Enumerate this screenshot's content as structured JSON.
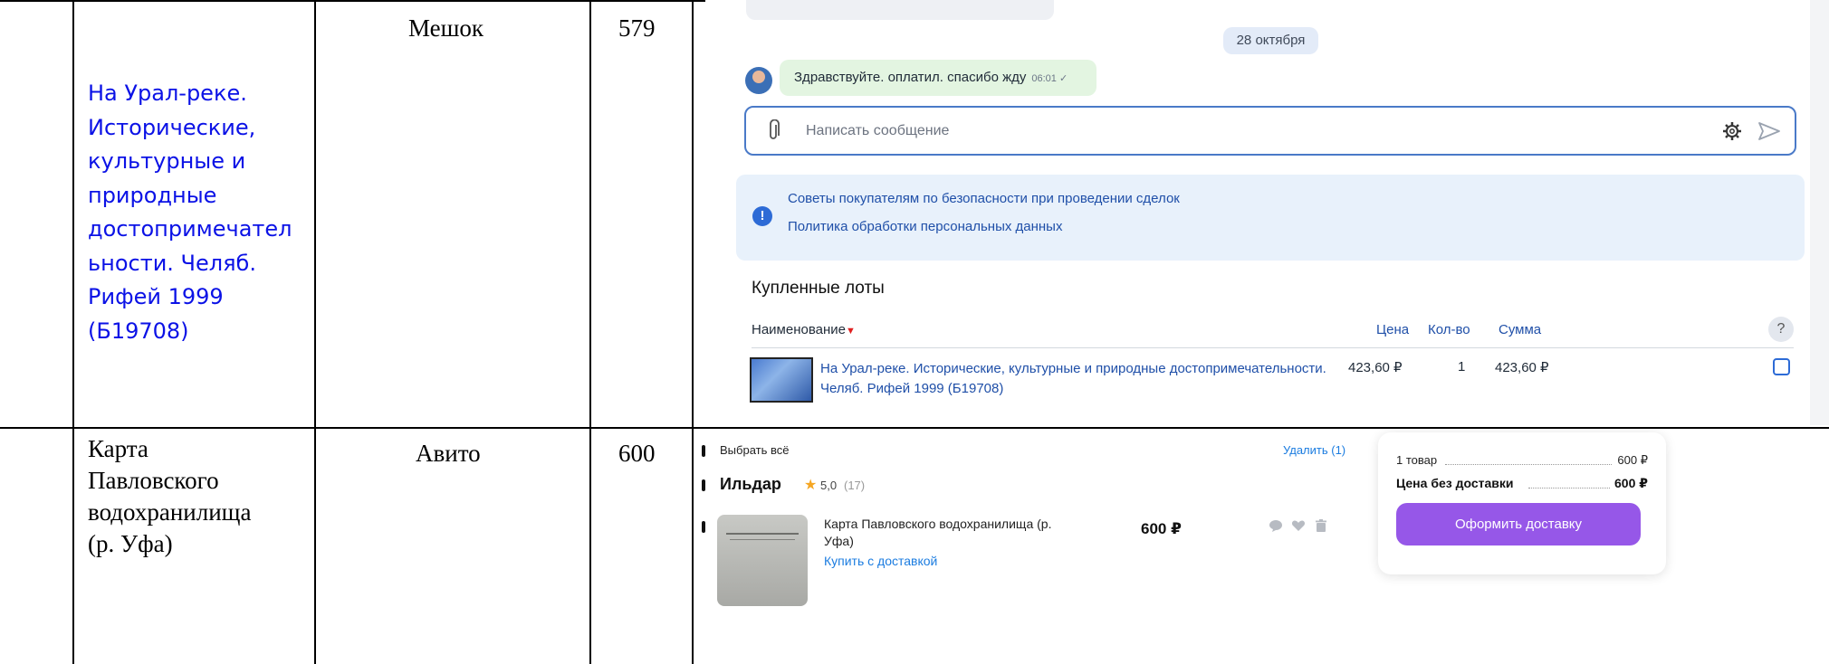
{
  "table": {
    "rows": [
      {
        "title": "На Урал-реке. Исторические, культурные и природные достопримечательности. Челяб. Рифей 1999 (Б19708)",
        "title_lines": [
          "На Урал-реке.",
          "Исторические,",
          "культурные и",
          "природные",
          "достопримечател",
          "ьности. Челяб.",
          "Рифей 1999",
          "(Б19708)"
        ],
        "source": "Мешок",
        "price": "579"
      },
      {
        "title_lines": [
          "Карта",
          "Павловского",
          "водохранилища",
          "(р. Уфа)"
        ],
        "source": "Авито",
        "price": "600"
      }
    ]
  },
  "meshok": {
    "date_chip": "28 октября",
    "message_text": "Здравствуйте. оплатил. спасибо жду",
    "message_time": "06:01 ✓",
    "compose_placeholder": "Написать сообщение",
    "info_links": [
      "Советы покупателям по безопасности при проведении сделок",
      "Политика обработки персональных данных"
    ],
    "bought_title": "Купленные лоты",
    "columns": {
      "name": "Наименование",
      "price": "Цена",
      "qty": "Кол-во",
      "sum": "Сумма",
      "help": "?"
    },
    "item": {
      "name": "На Урал-реке. Исторические, культурные и природные достопримечательности. Челяб. Рифей 1999 (Б19708)",
      "price": "423,60 ₽",
      "qty": "1",
      "sum": "423,60 ₽"
    }
  },
  "avito": {
    "select_all": "Выбрать всё",
    "delete": "Удалить (1)",
    "seller_name": "Ильдар",
    "seller_rating": "5,0",
    "seller_reviews": "(17)",
    "item_name": "Карта Павловского водохранилища (р. Уфа)",
    "item_buy_link": "Купить с доставкой",
    "item_price": "600 ₽",
    "summary": {
      "items_label": "1 товар",
      "items_value": "600 ₽",
      "total_label": "Цена без доставки",
      "total_value": "600 ₽",
      "button": "Оформить доставку"
    }
  }
}
